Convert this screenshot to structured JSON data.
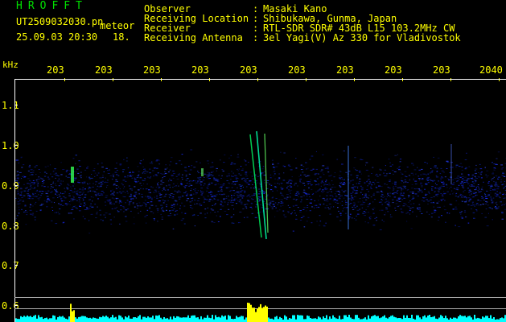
{
  "header": {
    "brand": "HROFFT",
    "filename": "UT2509032030.pn",
    "meteor_label": "meteor",
    "datetime": "25.09.03 20:30",
    "count": "18.",
    "info": [
      {
        "label": "Observer",
        "value": "Masaki Kano"
      },
      {
        "label": "Receiving Location",
        "value": "Shibukawa, Gunma, Japan"
      },
      {
        "label": "Receiver",
        "value": "RTL-SDR SDR# 43dB L15 103.2MHz CW"
      },
      {
        "label": "Receiving Antenna",
        "value": "3el Yagi(V) Az 330 for Vladivostok"
      }
    ]
  },
  "axes": {
    "y_unit": "kHz",
    "x_ticks": [
      "203",
      "203",
      "203",
      "203",
      "203",
      "203",
      "203",
      "203",
      "203",
      "2040"
    ],
    "y_ticks": [
      "1.1",
      "1.0",
      "0.9",
      "0.8",
      "0.7",
      "0.6"
    ]
  },
  "colors": {
    "header_text": "#ffff00",
    "brand": "#00e000",
    "background": "#000000",
    "noise_band": "#1a2cff",
    "meteor_trace": "#00ff66",
    "activity_bar": "#00ffff",
    "activity_peak": "#ffff00"
  }
}
